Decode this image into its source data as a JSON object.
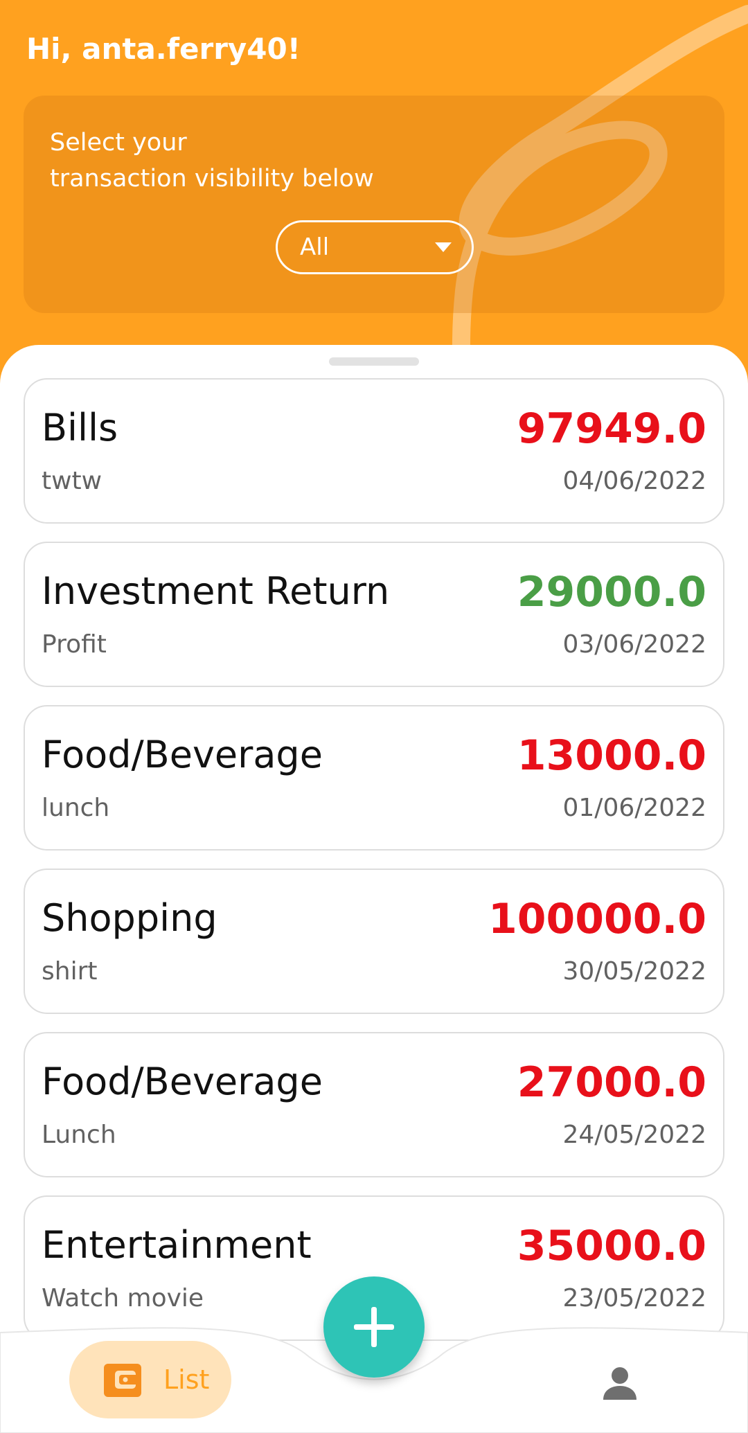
{
  "header": {
    "greeting": "Hi, anta.ferry40!",
    "visibility_line1": "Select your",
    "visibility_line2": "transaction visibility below",
    "visibility_selected": "All"
  },
  "transactions": [
    {
      "category": "Bills",
      "note": "twtw",
      "amount": "97949.0",
      "date": "04/06/2022",
      "type": "expense"
    },
    {
      "category": "Investment Return",
      "note": "Profit",
      "amount": "29000.0",
      "date": "03/06/2022",
      "type": "income"
    },
    {
      "category": "Food/Beverage",
      "note": "lunch",
      "amount": "13000.0",
      "date": "01/06/2022",
      "type": "expense"
    },
    {
      "category": "Shopping",
      "note": "shirt",
      "amount": "100000.0",
      "date": "30/05/2022",
      "type": "expense"
    },
    {
      "category": "Food/Beverage",
      "note": "Lunch",
      "amount": "27000.0",
      "date": "24/05/2022",
      "type": "expense"
    },
    {
      "category": "Entertainment",
      "note": "Watch movie",
      "amount": "35000.0",
      "date": "23/05/2022",
      "type": "expense"
    }
  ],
  "nav": {
    "list_label": "List",
    "list_icon": "wallet-icon",
    "add_icon": "plus-icon",
    "profile_icon": "person-icon"
  },
  "colors": {
    "brand": "#FFA11F",
    "expense": "#E8101A",
    "income": "#4A9E46",
    "fab": "#2EC4B6"
  }
}
